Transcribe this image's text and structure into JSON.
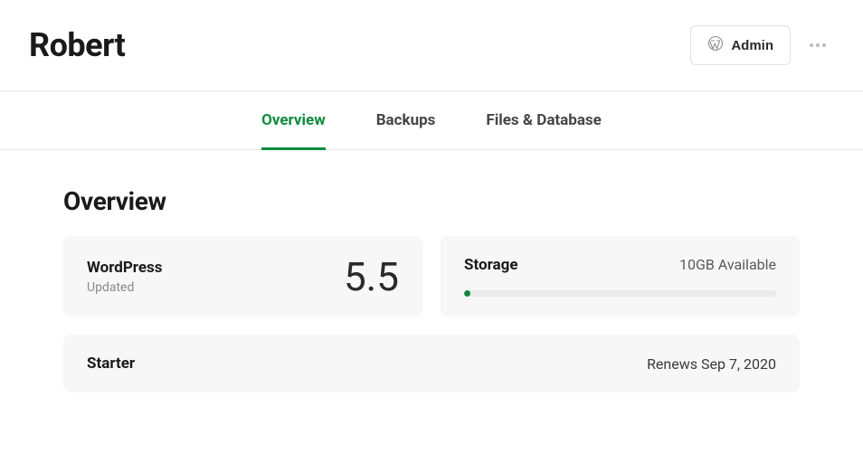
{
  "header": {
    "title": "Robert",
    "admin_label": "Admin"
  },
  "tabs": [
    {
      "label": "Overview",
      "active": true
    },
    {
      "label": "Backups",
      "active": false
    },
    {
      "label": "Files & Database",
      "active": false
    }
  ],
  "section": {
    "title": "Overview"
  },
  "wordpress": {
    "label": "WordPress",
    "status": "Updated",
    "version": "5.5"
  },
  "storage": {
    "label": "Storage",
    "available": "10GB Available",
    "used_percent": 2
  },
  "plan": {
    "name": "Starter",
    "renews": "Renews Sep 7, 2020"
  }
}
